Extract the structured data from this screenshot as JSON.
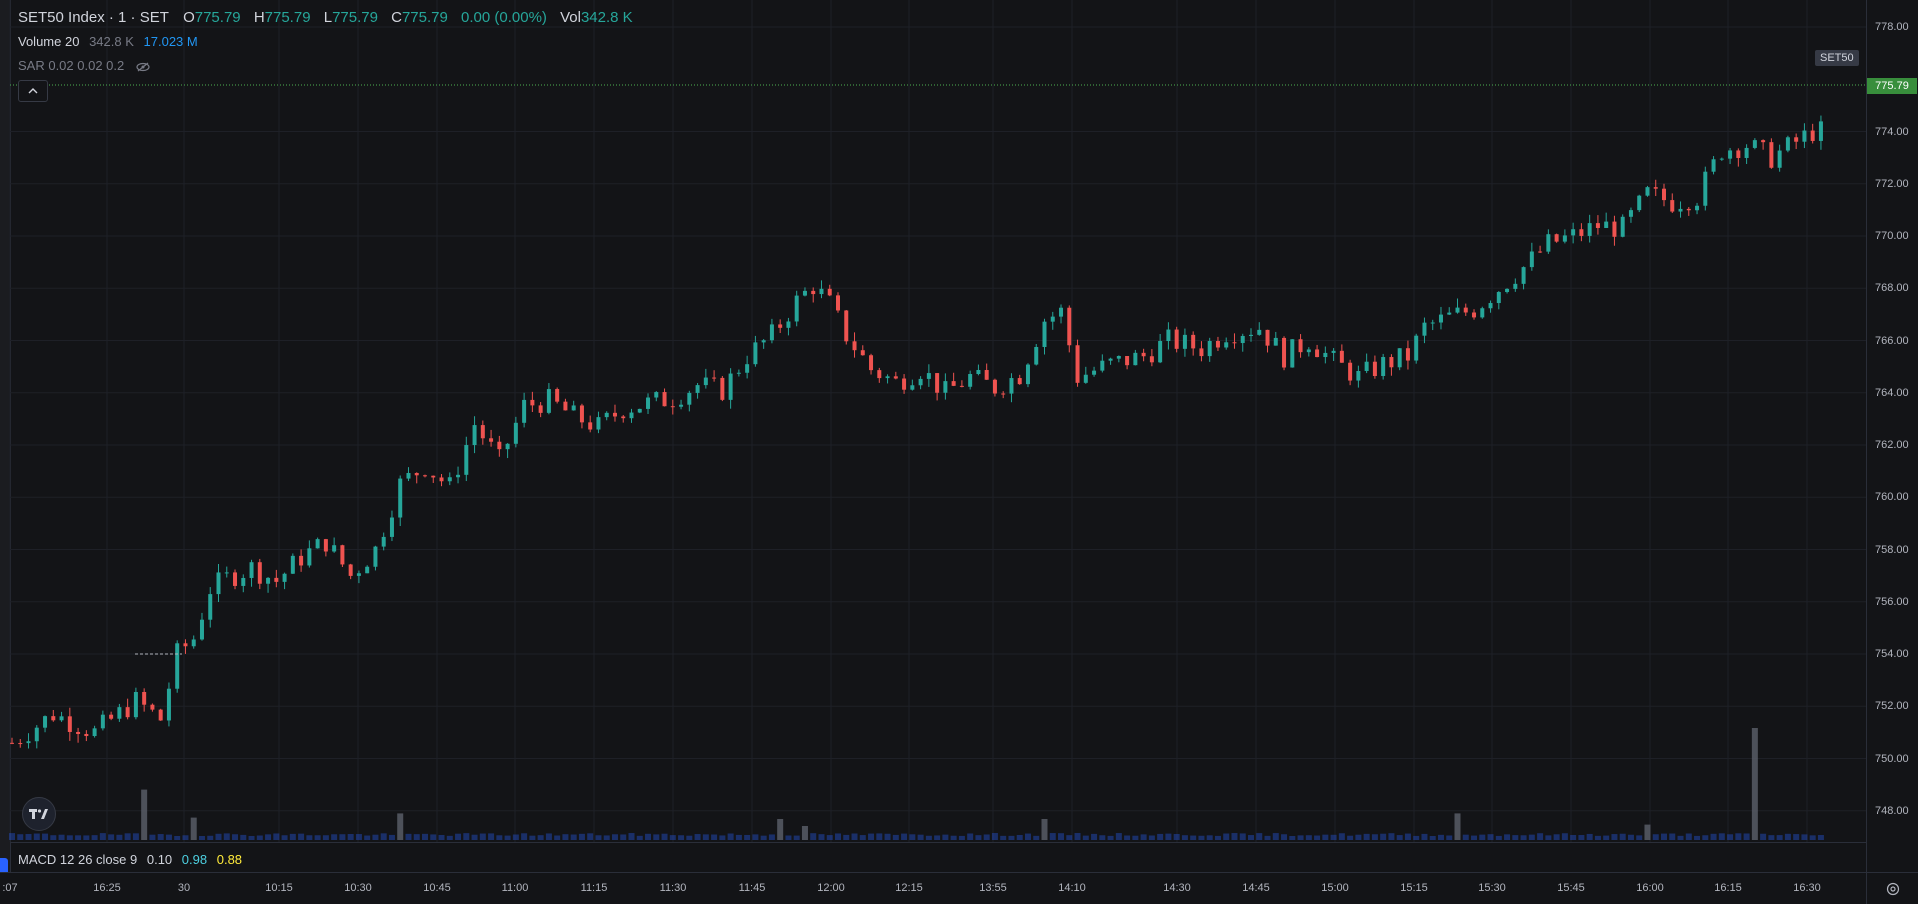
{
  "header": {
    "symbol_title": "SET50 Index · 1 · SET",
    "open_label": "O",
    "open_value": "775.79",
    "high_label": "H",
    "high_value": "775.79",
    "low_label": "L",
    "low_value": "775.79",
    "close_label": "C",
    "close_value": "775.79",
    "change_value": "0.00 (0.00%)",
    "vol_label": "Vol",
    "vol_value": "342.8 K"
  },
  "volume_indicator": {
    "name": "Volume 20",
    "value": "342.8 K",
    "ma_value": "17.023 M"
  },
  "sar_indicator": {
    "name": "SAR 0.02 0.02 0.2",
    "icon": "eye-off-icon"
  },
  "macd_indicator": {
    "name": "MACD 12 26 close 9",
    "macd": "0.10",
    "signal": "0.98",
    "hist": "0.88"
  },
  "price_axis": {
    "labels": [
      "778.00",
      "775.79",
      "774.00",
      "772.00",
      "770.00",
      "768.00",
      "766.00",
      "764.00",
      "762.00",
      "760.00",
      "758.00",
      "756.00",
      "754.00",
      "752.00",
      "750.00",
      "748.00"
    ],
    "symbol_tag": "SET50",
    "current_price": "775.79"
  },
  "time_axis": {
    "labels": [
      ":07",
      "16:25",
      "30",
      "10:15",
      "10:30",
      "10:45",
      "11:00",
      "11:15",
      "11:30",
      "11:45",
      "12:00",
      "12:15",
      "13:55",
      "14:10",
      "14:30",
      "14:45",
      "15:00",
      "15:15",
      "15:30",
      "15:45",
      "16:00",
      "16:15",
      "16:30"
    ]
  },
  "colors": {
    "up": "#26a69a",
    "down": "#ef5350",
    "volume": "#2962ff",
    "background": "#131417",
    "grid": "#1e2027"
  },
  "chart_data": {
    "type": "candlestick",
    "yrange": [
      747,
      779
    ],
    "keypoints": [
      [
        0,
        750.6
      ],
      [
        5,
        751.7
      ],
      [
        10,
        751.0
      ],
      [
        15,
        752.2
      ],
      [
        18,
        751.5
      ],
      [
        20,
        754.0
      ],
      [
        22,
        754.6
      ],
      [
        24,
        756.5
      ],
      [
        26,
        756.9
      ],
      [
        29,
        757.3
      ],
      [
        32,
        756.8
      ],
      [
        35,
        757.7
      ],
      [
        38,
        758.3
      ],
      [
        41,
        757.0
      ],
      [
        44,
        758.0
      ],
      [
        47,
        760.5
      ],
      [
        50,
        761.2
      ],
      [
        53,
        760.4
      ],
      [
        56,
        762.8
      ],
      [
        59,
        761.4
      ],
      [
        62,
        763.5
      ],
      [
        65,
        763.7
      ],
      [
        68,
        763.1
      ],
      [
        71,
        762.7
      ],
      [
        74,
        763.4
      ],
      [
        77,
        763.6
      ],
      [
        80,
        763.8
      ],
      [
        83,
        764.3
      ],
      [
        86,
        764.1
      ],
      [
        89,
        765.4
      ],
      [
        92,
        766.2
      ],
      [
        95,
        767.5
      ],
      [
        97,
        768.1
      ],
      [
        99,
        767.4
      ],
      [
        101,
        766.2
      ],
      [
        104,
        764.9
      ],
      [
        107,
        764.4
      ],
      [
        110,
        764.9
      ],
      [
        113,
        764.0
      ],
      [
        116,
        764.6
      ],
      [
        119,
        764.2
      ],
      [
        122,
        764.7
      ],
      [
        125,
        766.8
      ],
      [
        127,
        767.1
      ],
      [
        129,
        764.6
      ],
      [
        133,
        765.1
      ],
      [
        137,
        765.4
      ],
      [
        140,
        766.0
      ],
      [
        144,
        765.7
      ],
      [
        147,
        766.3
      ],
      [
        151,
        766.5
      ],
      [
        154,
        765.4
      ],
      [
        157,
        766.0
      ],
      [
        160,
        765.2
      ],
      [
        163,
        764.6
      ],
      [
        166,
        765.1
      ],
      [
        169,
        765.4
      ],
      [
        171,
        766.5
      ],
      [
        174,
        766.9
      ],
      [
        177,
        767.2
      ],
      [
        180,
        768.0
      ],
      [
        183,
        768.8
      ],
      [
        186,
        769.7
      ],
      [
        189,
        770.0
      ],
      [
        192,
        770.4
      ],
      [
        195,
        770.3
      ],
      [
        198,
        771.6
      ],
      [
        201,
        771.3
      ],
      [
        204,
        771.5
      ],
      [
        207,
        773.3
      ],
      [
        210,
        773.5
      ],
      [
        213,
        773.0
      ],
      [
        216,
        773.6
      ],
      [
        218,
        774.0
      ]
    ],
    "volume_spikes": [
      [
        16,
        3.6
      ],
      [
        22,
        1.6
      ],
      [
        47,
        1.9
      ],
      [
        93,
        1.5
      ],
      [
        96,
        1.0
      ],
      [
        125,
        1.5
      ],
      [
        175,
        1.9
      ],
      [
        198,
        1.1
      ],
      [
        211,
        8.0
      ]
    ]
  }
}
